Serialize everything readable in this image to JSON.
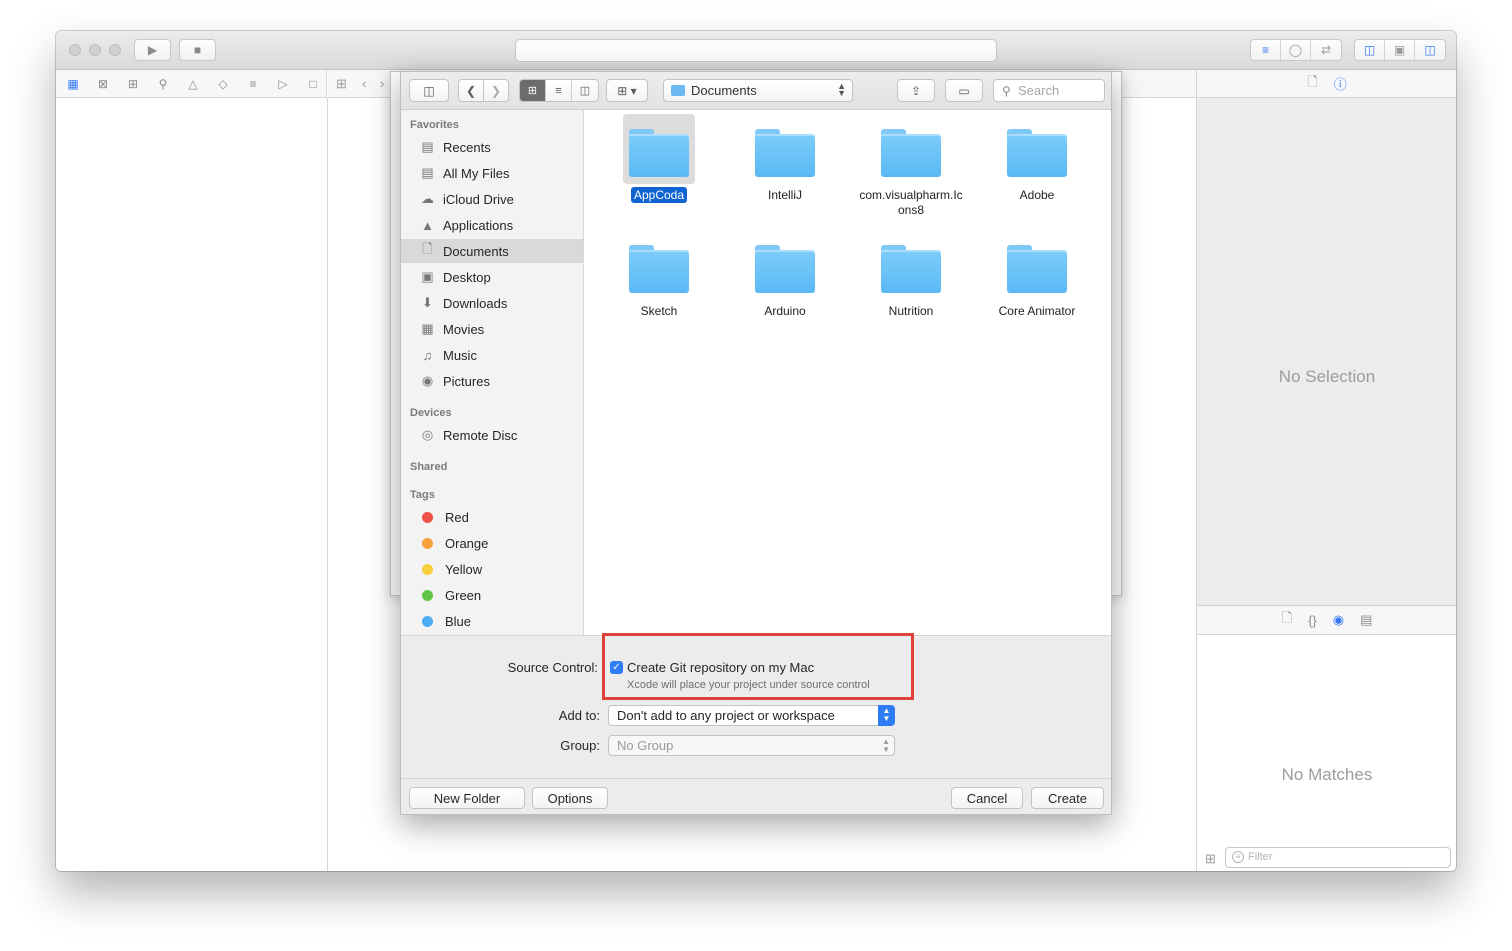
{
  "dialog": {
    "toolbar": {
      "sidebar_toggle_icon": "sidebar-icon",
      "back_icon": "chevron-left-icon",
      "forward_icon": "chevron-right-icon",
      "view_modes": [
        "icon-view",
        "list-view",
        "column-view"
      ],
      "arrange_icon": "arrange-icon",
      "location": "Documents",
      "share_icon": "share-icon",
      "tag_icon": "tag-icon",
      "search_placeholder": "Search"
    },
    "sidebar": {
      "favorites_header": "Favorites",
      "favorites": [
        {
          "label": "Recents",
          "icon": "recents-icon"
        },
        {
          "label": "All My Files",
          "icon": "all-files-icon"
        },
        {
          "label": "iCloud Drive",
          "icon": "cloud-icon"
        },
        {
          "label": "Applications",
          "icon": "applications-icon"
        },
        {
          "label": "Documents",
          "icon": "documents-icon",
          "selected": true
        },
        {
          "label": "Desktop",
          "icon": "desktop-icon"
        },
        {
          "label": "Downloads",
          "icon": "downloads-icon"
        },
        {
          "label": "Movies",
          "icon": "movies-icon"
        },
        {
          "label": "Music",
          "icon": "music-icon"
        },
        {
          "label": "Pictures",
          "icon": "pictures-icon"
        }
      ],
      "devices_header": "Devices",
      "devices": [
        {
          "label": "Remote Disc",
          "icon": "disc-icon"
        }
      ],
      "shared_header": "Shared",
      "tags_header": "Tags",
      "tags": [
        {
          "label": "Red",
          "color": "#ec5047"
        },
        {
          "label": "Orange",
          "color": "#f5a23a"
        },
        {
          "label": "Yellow",
          "color": "#f6cf3b"
        },
        {
          "label": "Green",
          "color": "#5ec546"
        },
        {
          "label": "Blue",
          "color": "#4aaef0"
        }
      ]
    },
    "files": [
      {
        "name": "AppCoda",
        "selected": true
      },
      {
        "name": "IntelliJ"
      },
      {
        "name": "com.visualpharm.Icons8"
      },
      {
        "name": "Adobe"
      },
      {
        "name": "Sketch"
      },
      {
        "name": "Arduino"
      },
      {
        "name": "Nutrition"
      },
      {
        "name": "Core Animator"
      }
    ],
    "options": {
      "source_control_label": "Source Control:",
      "git_checkbox_label": "Create Git repository on my Mac",
      "git_checked": true,
      "git_hint": "Xcode will place your project under source control",
      "add_to_label": "Add to:",
      "add_to_value": "Don't add to any project or workspace",
      "group_label": "Group:",
      "group_value": "No Group"
    },
    "footer": {
      "new_folder": "New Folder",
      "options": "Options",
      "cancel": "Cancel",
      "create": "Create"
    }
  },
  "inspector": {
    "no_selection": "No Selection",
    "no_matches": "No Matches",
    "filter_placeholder": "Filter"
  },
  "colors": {
    "accent": "#3478f6",
    "highlight_border": "#e0423a",
    "folder": "#6cc2f8"
  }
}
